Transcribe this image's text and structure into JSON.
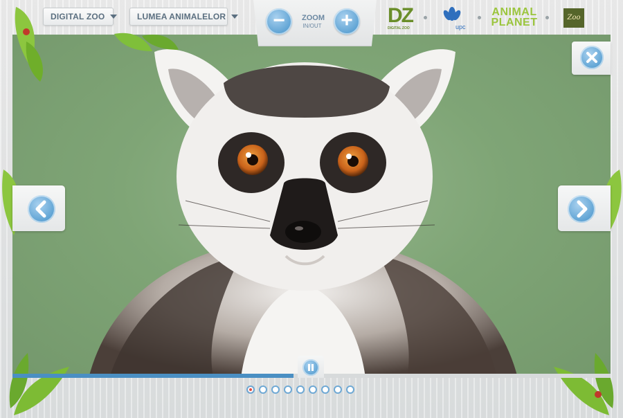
{
  "header": {
    "category_dropdown": "DIGITAL ZOO",
    "section_dropdown": "LUMEA ANIMALELOR",
    "zoom_label": "ZOOM",
    "zoom_sublabel": "IN/OUT",
    "zoom_out_glyph": "−",
    "zoom_in_glyph": "+"
  },
  "sponsors": {
    "dz_logo": "DZ",
    "dz_sub": "DIGITAL ZOO",
    "upc_logo": "upc",
    "animal_planet_logo": "ANIMAL PLANET",
    "zoo_logo": "Zoo"
  },
  "viewer": {
    "image_subject": "ring-tailed-lemur",
    "progress": 0.47,
    "page_count": 9,
    "active_page": 1
  },
  "colors": {
    "accent_blue": "#5da2d3",
    "photo_bg": "#7fa576",
    "active_dot": "#e24a3c"
  },
  "icons": {
    "close": "close-icon",
    "prev": "arrow-left-icon",
    "next": "arrow-right-icon",
    "pause": "pause-icon"
  }
}
